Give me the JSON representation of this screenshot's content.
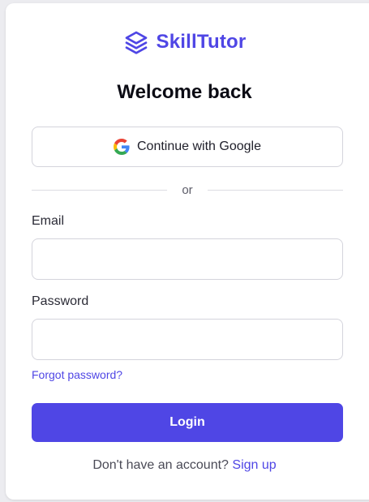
{
  "brand": {
    "name": "SkillTutor",
    "icon": "layers-icon",
    "color": "#4f46e5"
  },
  "heading": "Welcome back",
  "google": {
    "label": "Continue with Google",
    "icon": "google-icon"
  },
  "divider": "or",
  "email": {
    "label": "Email",
    "value": "",
    "placeholder": ""
  },
  "password": {
    "label": "Password",
    "value": "",
    "placeholder": ""
  },
  "forgot": "Forgot password?",
  "login": "Login",
  "signup": {
    "prompt": "Don't have an account?",
    "link": "Sign up"
  },
  "colors": {
    "accent": "#4f46e5",
    "background": "#ececf0",
    "card": "#ffffff"
  }
}
